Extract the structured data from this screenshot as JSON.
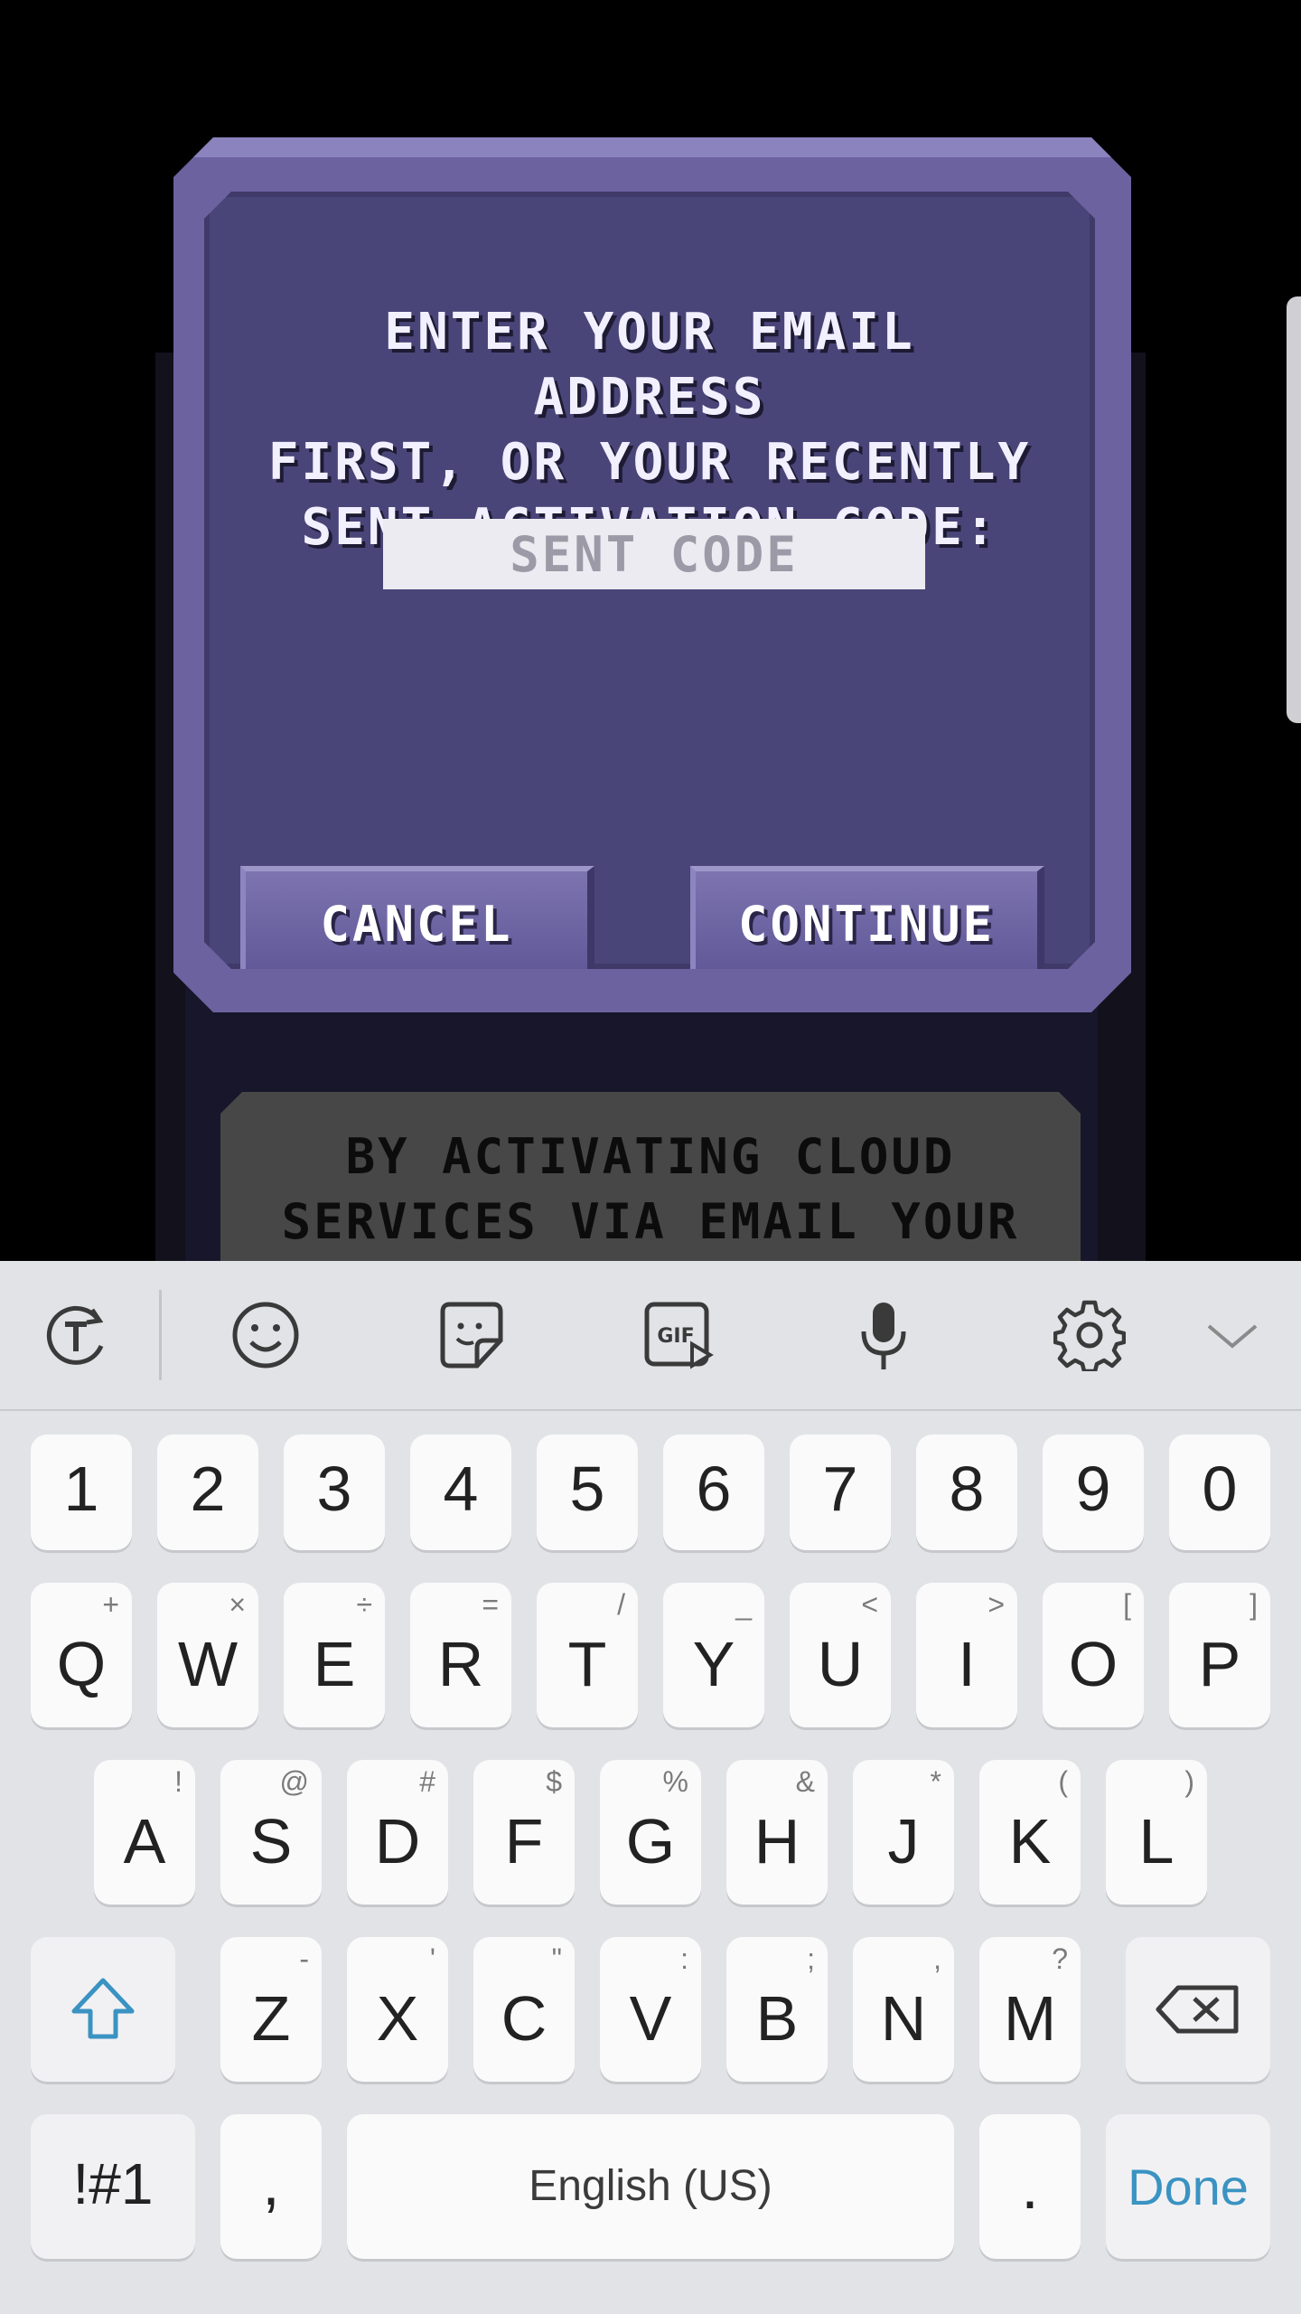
{
  "dialog": {
    "message": "ENTER YOUR EMAIL ADDRESS\nFIRST, OR YOUR RECENTLY\nSENT ACTIVATION CODE:",
    "input_placeholder": "SENT CODE",
    "cancel_label": "CANCEL",
    "continue_label": "CONTINUE"
  },
  "background_panel": {
    "text": "BY ACTIVATING CLOUD\nSERVICES VIA EMAIL YOUR"
  },
  "keyboard": {
    "toolbar_icons": [
      "text-correction-icon",
      "emoji-icon",
      "sticker-icon",
      "gif-icon",
      "microphone-icon",
      "settings-icon",
      "collapse-chevron-icon"
    ],
    "number_row": [
      "1",
      "2",
      "3",
      "4",
      "5",
      "6",
      "7",
      "8",
      "9",
      "0"
    ],
    "row1": [
      {
        "main": "Q",
        "sub": "+"
      },
      {
        "main": "W",
        "sub": "×"
      },
      {
        "main": "E",
        "sub": "÷"
      },
      {
        "main": "R",
        "sub": "="
      },
      {
        "main": "T",
        "sub": "/"
      },
      {
        "main": "Y",
        "sub": "_"
      },
      {
        "main": "U",
        "sub": "<"
      },
      {
        "main": "I",
        "sub": ">"
      },
      {
        "main": "O",
        "sub": "["
      },
      {
        "main": "P",
        "sub": "]"
      }
    ],
    "row2": [
      {
        "main": "A",
        "sub": "!"
      },
      {
        "main": "S",
        "sub": "@"
      },
      {
        "main": "D",
        "sub": "#"
      },
      {
        "main": "F",
        "sub": "$"
      },
      {
        "main": "G",
        "sub": "%"
      },
      {
        "main": "H",
        "sub": "&"
      },
      {
        "main": "J",
        "sub": "*"
      },
      {
        "main": "K",
        "sub": "("
      },
      {
        "main": "L",
        "sub": ")"
      }
    ],
    "row3": [
      {
        "main": "Z",
        "sub": "-"
      },
      {
        "main": "X",
        "sub": "'"
      },
      {
        "main": "C",
        "sub": "\""
      },
      {
        "main": "V",
        "sub": ":"
      },
      {
        "main": "B",
        "sub": ";"
      },
      {
        "main": "N",
        "sub": ","
      },
      {
        "main": "M",
        "sub": "?"
      }
    ],
    "symbols_label": "!#1",
    "comma_label": ",",
    "space_label": "English (US)",
    "period_label": ".",
    "done_label": "Done",
    "accent_color": "#3a93c2"
  }
}
